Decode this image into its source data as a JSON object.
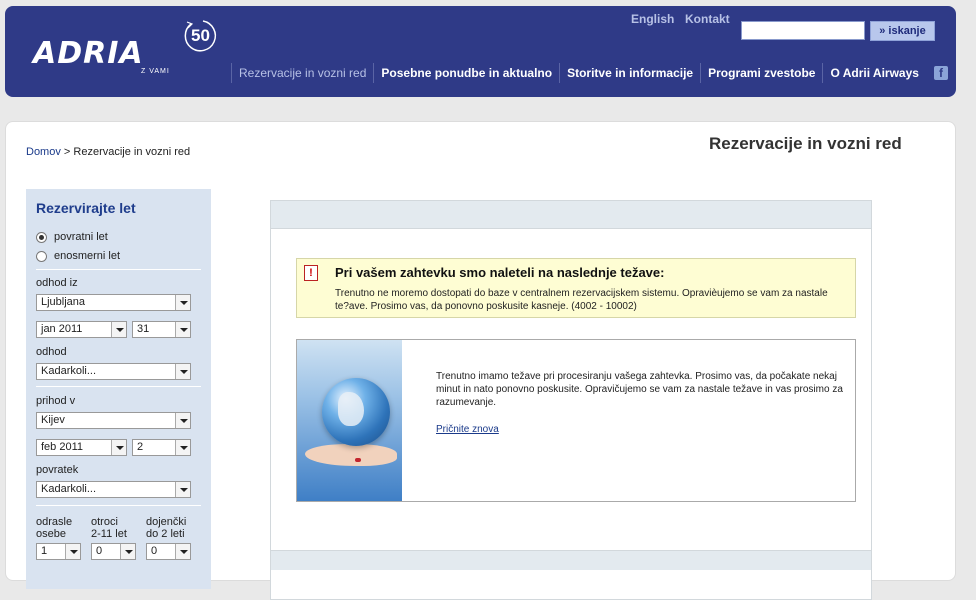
{
  "header": {
    "logo_text": "ADRIA",
    "logo_anniversary": "50",
    "logo_tagline": "Z VAMI",
    "links": {
      "english": "English",
      "contact": "Kontakt"
    },
    "search": {
      "value": "",
      "button": "» iskanje"
    },
    "nav": [
      "Rezervacije in vozni red",
      "Posebne ponudbe in aktualno",
      "Storitve in informacije",
      "Programi zvestobe",
      "O Adrii Airways"
    ],
    "facebook": "f"
  },
  "breadcrumb": {
    "home": "Domov",
    "separator": " > ",
    "current": "Rezervacije in vozni red"
  },
  "page_title": "Rezervacije in vozni red",
  "booking": {
    "title": "Rezervirajte let",
    "trip_types": [
      "povratni let",
      "enosmerni let"
    ],
    "departure_from_label": "odhod iz",
    "departure_from": "Ljubljana",
    "departure_month": "jan 2011",
    "departure_day": "31",
    "departure_time_label": "odhod",
    "departure_time": "Kadarkoli...",
    "arrival_to_label": "prihod v",
    "arrival_to": "Kijev",
    "return_month": "feb 2011",
    "return_day": "2",
    "return_time_label": "povratek",
    "return_time": "Kadarkoli...",
    "adults_label_1": "odrasle",
    "adults_label_2": "osebe",
    "children_label_1": "otroci",
    "children_label_2": "2-11 let",
    "infants_label_1": "dojenčki",
    "infants_label_2": "do 2 leti",
    "adults": "1",
    "children": "0",
    "infants": "0"
  },
  "alert": {
    "icon": "!",
    "title": "Pri vašem zahtevku smo naleteli na naslednje težave:",
    "text": "Trenutno ne moremo dostopati do baze v centralnem rezervacijskem sistemu. Opravièujemo se vam za nastale te?ave. Prosimo vas, da ponovno poskusite kasneje. (4002 - 10002)"
  },
  "info": {
    "text": "Trenutno imamo težave pri procesiranju vašega zahtevka. Prosimo vas, da počakate nekaj minut in nato ponovno poskusite. Opravičujemo se vam za nastale težave in vas prosimo za razumevanje.",
    "retry": "Pričnite znova"
  },
  "colors": {
    "header_bg": "#2f3a87",
    "sidebar_bg": "#d9e3f0",
    "alert_bg": "#fefdd3"
  }
}
